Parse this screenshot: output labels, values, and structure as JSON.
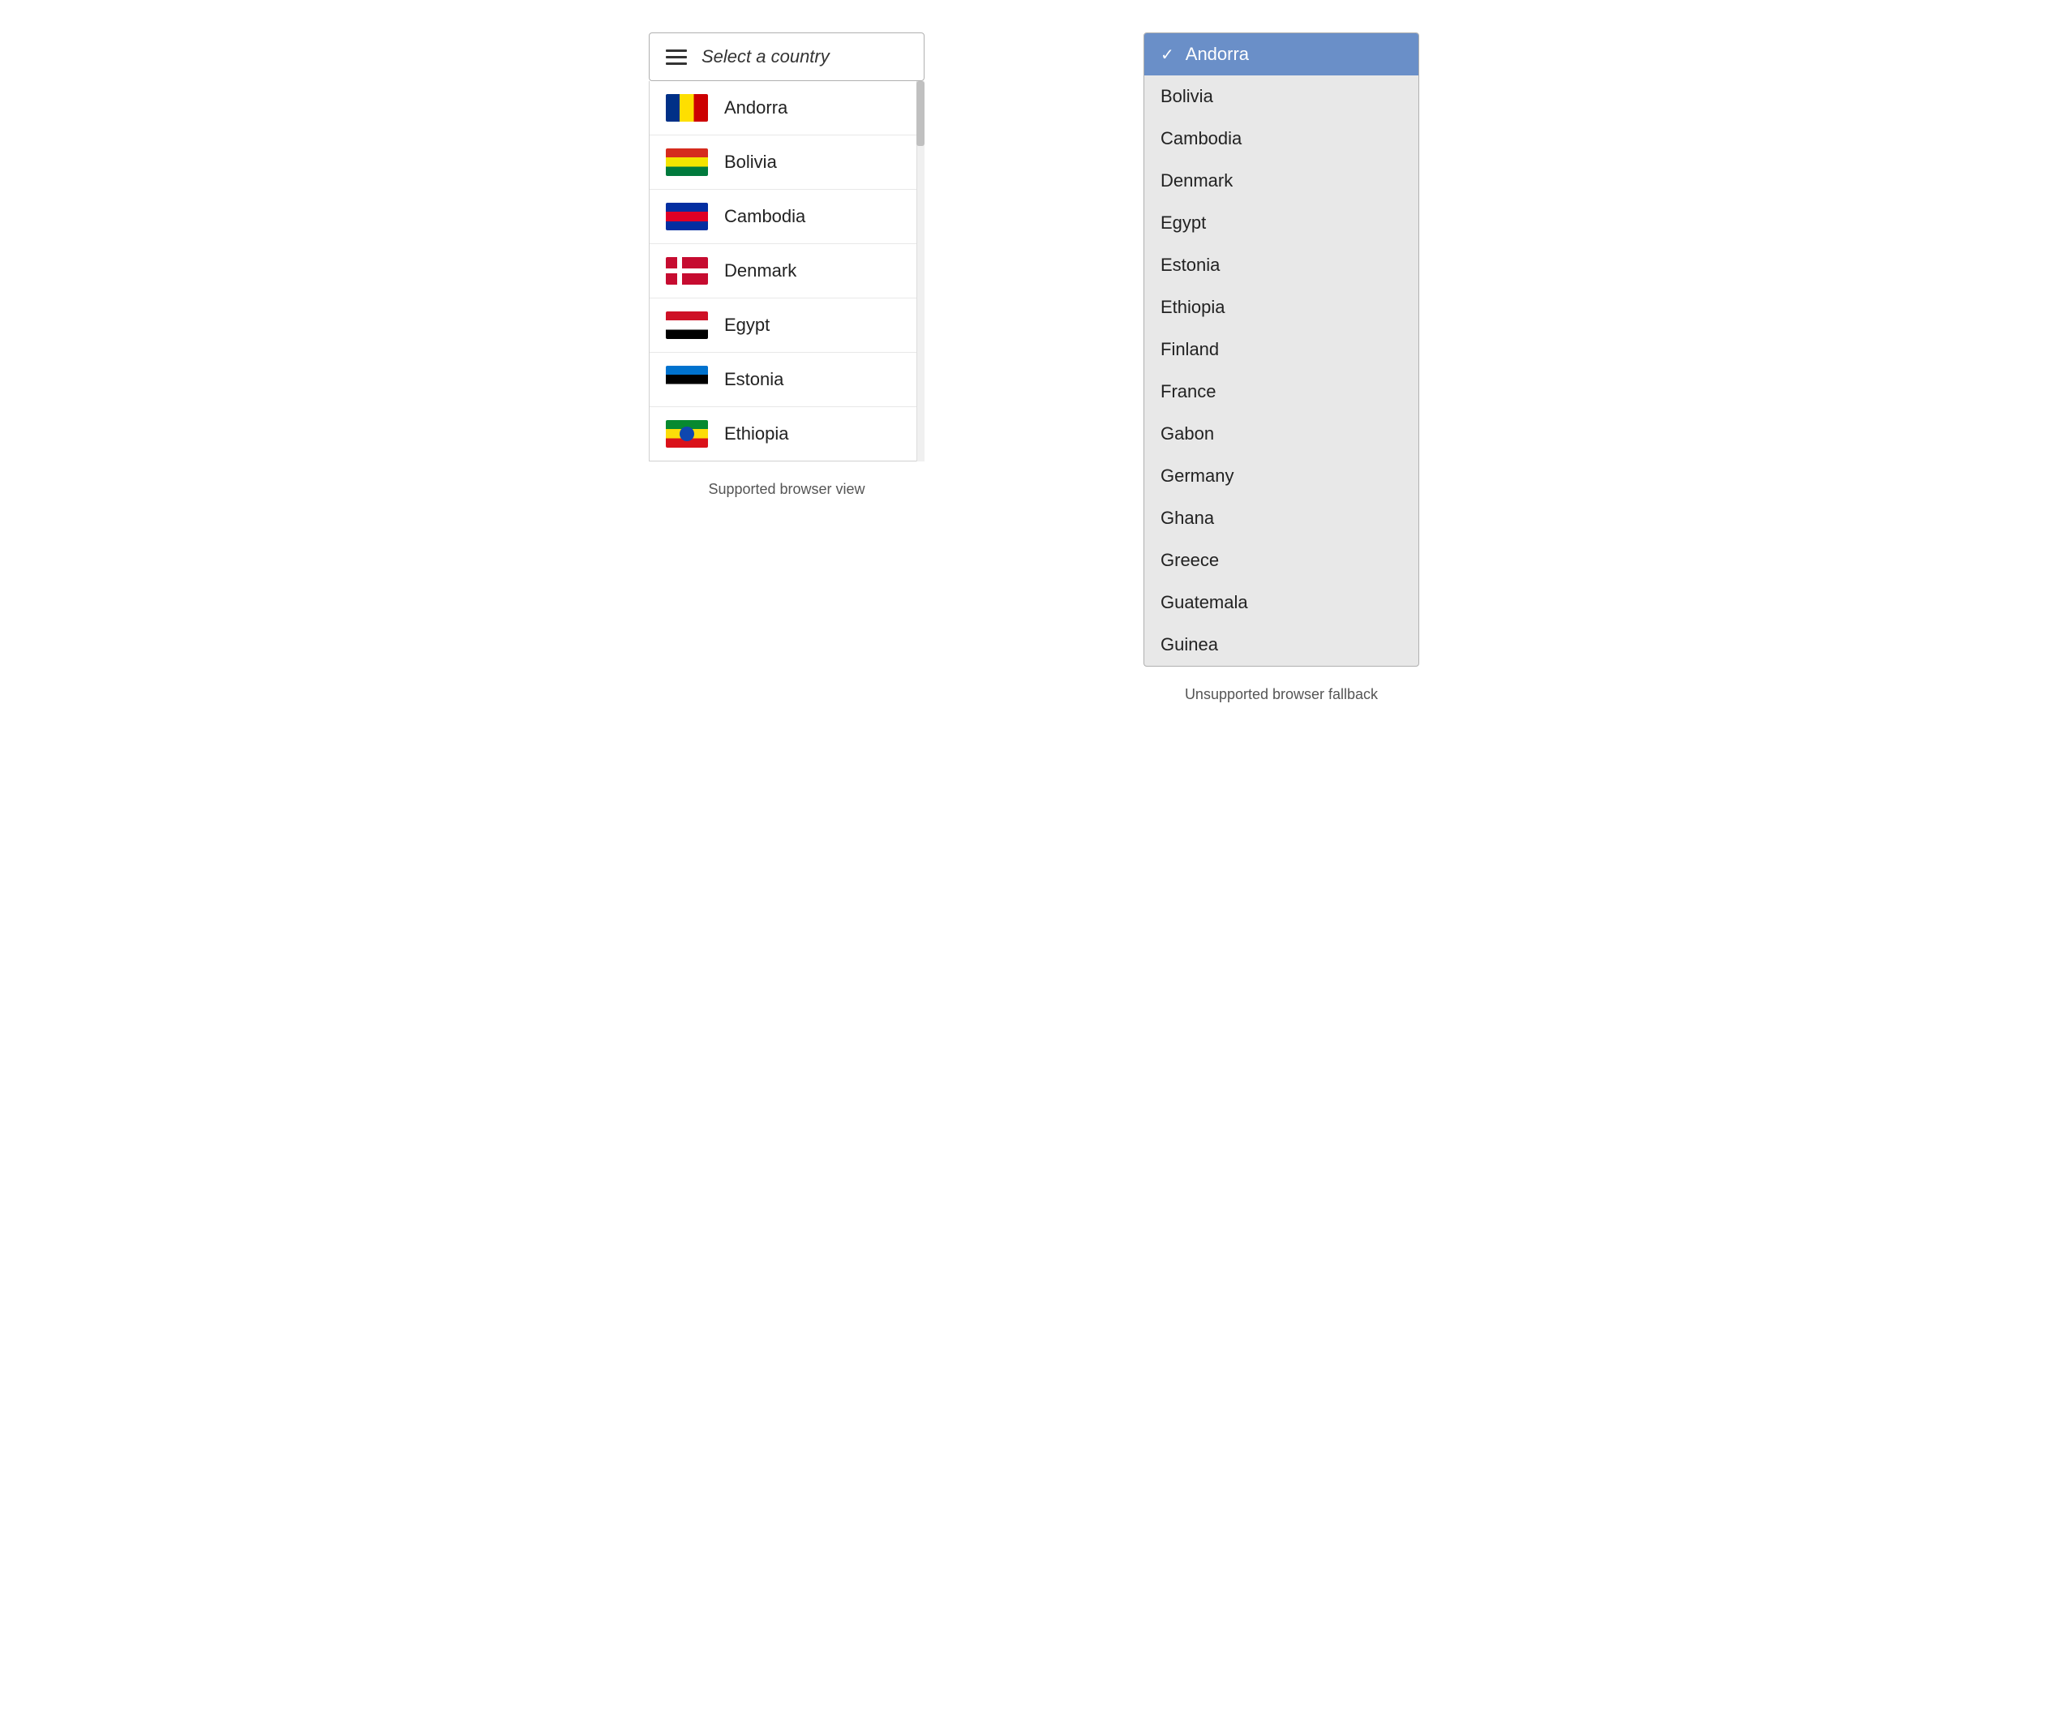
{
  "left": {
    "trigger": {
      "placeholder": "Select a country"
    },
    "items": [
      {
        "name": "Andorra",
        "flag": "ad"
      },
      {
        "name": "Bolivia",
        "flag": "bo"
      },
      {
        "name": "Cambodia",
        "flag": "kh"
      },
      {
        "name": "Denmark",
        "flag": "dk"
      },
      {
        "name": "Egypt",
        "flag": "eg"
      },
      {
        "name": "Estonia",
        "flag": "ee"
      },
      {
        "name": "Ethiopia",
        "flag": "et"
      }
    ],
    "caption": "Supported browser view"
  },
  "right": {
    "items": [
      {
        "name": "Andorra",
        "selected": true
      },
      {
        "name": "Bolivia",
        "selected": false
      },
      {
        "name": "Cambodia",
        "selected": false
      },
      {
        "name": "Denmark",
        "selected": false
      },
      {
        "name": "Egypt",
        "selected": false
      },
      {
        "name": "Estonia",
        "selected": false
      },
      {
        "name": "Ethiopia",
        "selected": false
      },
      {
        "name": "Finland",
        "selected": false
      },
      {
        "name": "France",
        "selected": false
      },
      {
        "name": "Gabon",
        "selected": false
      },
      {
        "name": "Germany",
        "selected": false
      },
      {
        "name": "Ghana",
        "selected": false
      },
      {
        "name": "Greece",
        "selected": false
      },
      {
        "name": "Guatemala",
        "selected": false
      },
      {
        "name": "Guinea",
        "selected": false
      }
    ],
    "caption": "Unsupported browser fallback"
  }
}
